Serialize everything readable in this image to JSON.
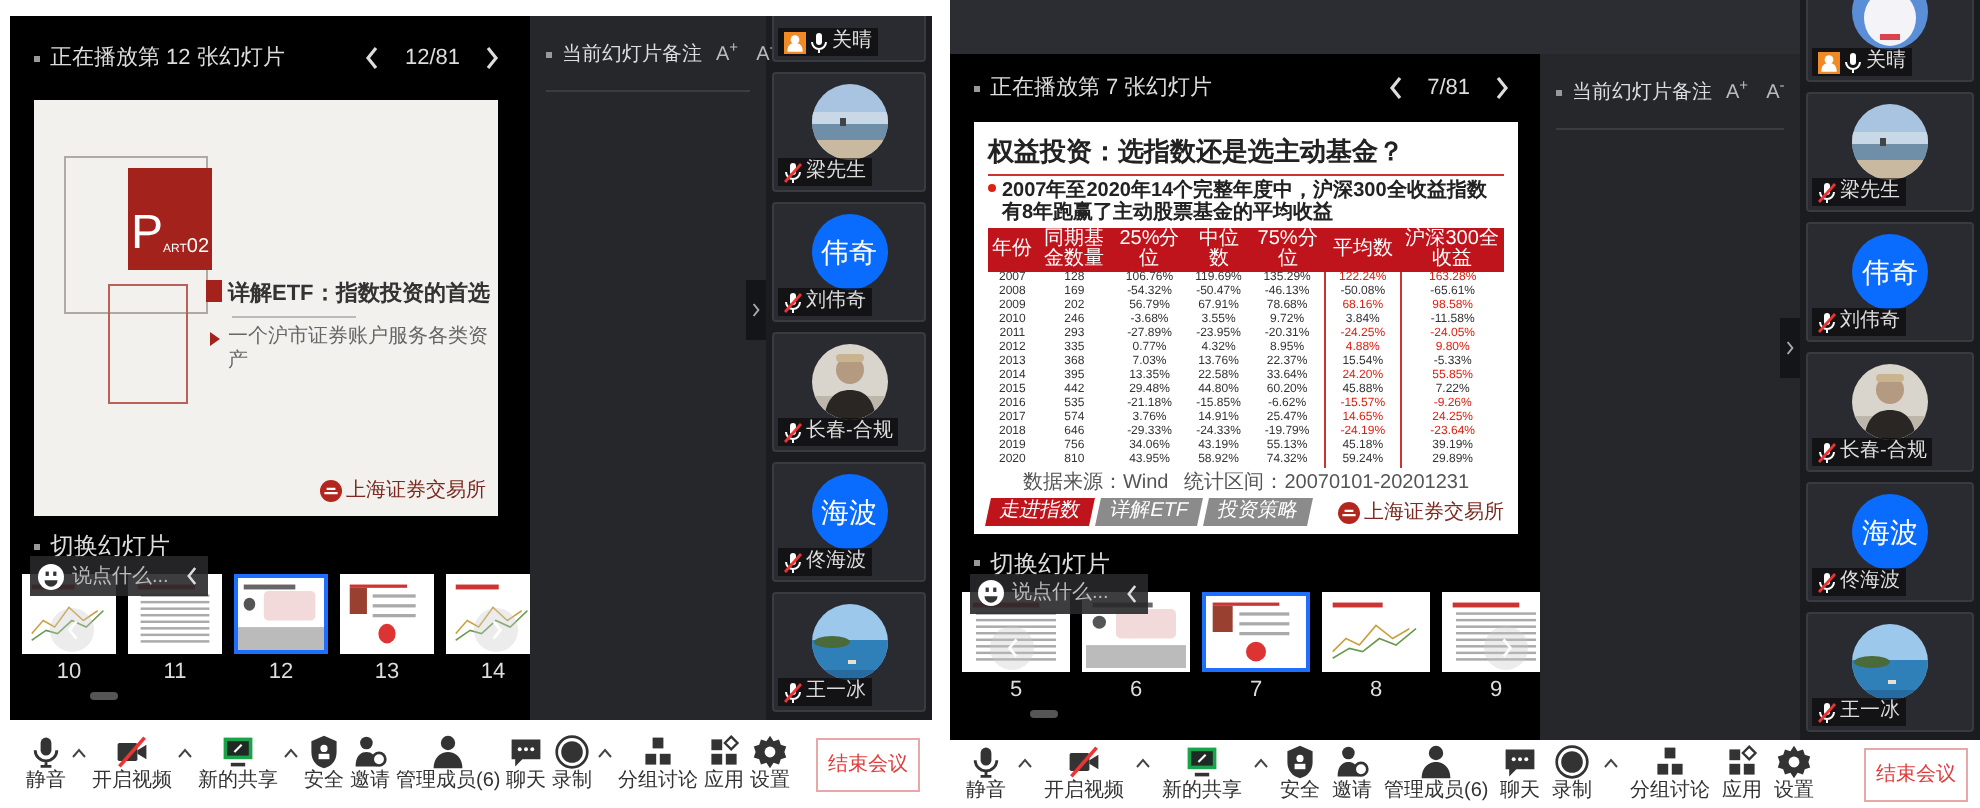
{
  "panels": [
    {
      "slide_status": "正在播放第 12 张幻灯片",
      "page": "12/81",
      "slide": {
        "kind": "section",
        "badge": {
          "letter": "P",
          "small": "ART",
          "number": "02"
        },
        "title": "详解ETF：指数投资的首选",
        "subtitle": "一个沪市证券账户服务各类资产",
        "logo": "上海证券交易所"
      },
      "switch_label": "切换幻灯片",
      "chat_placeholder": "说点什么...",
      "thumbnails": [
        {
          "number": "10",
          "selected": false
        },
        {
          "number": "11",
          "selected": false
        },
        {
          "number": "12",
          "selected": true
        },
        {
          "number": "13",
          "selected": false
        },
        {
          "number": "14",
          "selected": false
        }
      ],
      "notes": {
        "title": "当前幻灯片备注",
        "font_buttons": [
          "A$^{+}$",
          "A$^{-}$"
        ]
      },
      "participants": [
        {
          "name": "关晴",
          "host": true,
          "muted": false
        },
        {
          "name": "梁先生",
          "host": false,
          "muted": true
        },
        {
          "name": "刘伟奇",
          "kind": "initials",
          "initials": "伟奇",
          "host": false,
          "muted": true
        },
        {
          "name": "长春-合规",
          "kind": "figure",
          "host": false,
          "muted": true
        },
        {
          "name": "佟海波",
          "kind": "initials",
          "initials": "海波",
          "host": false,
          "muted": true
        },
        {
          "name": "王一冰",
          "host": false,
          "muted": true
        }
      ],
      "toolbar": [
        {
          "label": "静音",
          "kind": "mic",
          "menu": true
        },
        {
          "label": "开启视频",
          "kind": "camera_off",
          "menu": true
        },
        {
          "label": "新的共享",
          "kind": "share",
          "menu": true
        },
        {
          "label": "安全",
          "kind": "shield",
          "menu": false
        },
        {
          "label": "邀请",
          "kind": "invite",
          "menu": false
        },
        {
          "label": "管理成员(6)",
          "kind": "members",
          "menu": false
        },
        {
          "label": "聊天",
          "kind": "chat",
          "menu": false
        },
        {
          "label": "录制",
          "kind": "record",
          "menu": true
        },
        {
          "label": "分组讨论",
          "kind": "group",
          "menu": false
        },
        {
          "label": "应用",
          "kind": "apps",
          "menu": false
        },
        {
          "label": "设置",
          "kind": "gear",
          "menu": false
        }
      ],
      "end_button": "结束会议"
    },
    {
      "slide_status": "正在播放第 7 张幻灯片",
      "page": "7/81",
      "slide": {
        "kind": "table",
        "title": "权益投资：选指数还是选主动基金？",
        "summary": "2007年至2020年14个完整年度中，沪深300全收益指数有**8年**跑赢了主动股票基金的平均收益",
        "columns": [
          "年份",
          "同期基金数量",
          "25%分位",
          "中位数",
          "75%分位",
          "平均数",
          "沪深300全收益"
        ],
        "rows": [
          {
            "cells": [
              "2007",
              "128",
              "106.76%",
              "119.69%",
              "135.29%",
              "122.24%",
              "163.28%"
            ],
            "highlight": true
          },
          {
            "cells": [
              "2008",
              "169",
              "-54.32%",
              "-50.47%",
              "-46.13%",
              "-50.08%",
              "-65.61%"
            ],
            "highlight": false
          },
          {
            "cells": [
              "2009",
              "202",
              "56.79%",
              "67.91%",
              "78.68%",
              "68.16%",
              "98.58%"
            ],
            "highlight": true
          },
          {
            "cells": [
              "2010",
              "246",
              "-3.68%",
              "3.55%",
              "9.72%",
              "3.84%",
              "-11.58%"
            ],
            "highlight": false
          },
          {
            "cells": [
              "2011",
              "293",
              "-27.89%",
              "-23.95%",
              "-20.31%",
              "-24.25%",
              "-24.05%"
            ],
            "highlight": true
          },
          {
            "cells": [
              "2012",
              "335",
              "0.77%",
              "4.32%",
              "8.95%",
              "4.88%",
              "9.80%"
            ],
            "highlight": true
          },
          {
            "cells": [
              "2013",
              "368",
              "7.03%",
              "13.76%",
              "22.37%",
              "15.54%",
              "-5.33%"
            ],
            "highlight": false
          },
          {
            "cells": [
              "2014",
              "395",
              "13.35%",
              "22.58%",
              "33.64%",
              "24.20%",
              "55.85%"
            ],
            "highlight": true
          },
          {
            "cells": [
              "2015",
              "442",
              "29.48%",
              "44.80%",
              "60.20%",
              "45.88%",
              "7.22%"
            ],
            "highlight": false
          },
          {
            "cells": [
              "2016",
              "535",
              "-21.18%",
              "-15.85%",
              "-6.62%",
              "-15.57%",
              "-9.26%"
            ],
            "highlight": true
          },
          {
            "cells": [
              "2017",
              "574",
              "3.76%",
              "14.91%",
              "25.47%",
              "14.65%",
              "24.25%"
            ],
            "highlight": true
          },
          {
            "cells": [
              "2018",
              "646",
              "-29.33%",
              "-24.33%",
              "-19.79%",
              "-24.19%",
              "-23.64%"
            ],
            "highlight": true
          },
          {
            "cells": [
              "2019",
              "756",
              "34.06%",
              "43.19%",
              "55.13%",
              "45.18%",
              "39.19%"
            ],
            "highlight": false
          },
          {
            "cells": [
              "2020",
              "810",
              "43.95%",
              "58.92%",
              "74.32%",
              "59.24%",
              "29.89%"
            ],
            "highlight": false
          }
        ],
        "source": [
          "数据来源：Wind",
          "统计区间：20070101-20201231"
        ],
        "tabs": [
          {
            "label": "走进指数",
            "selected": true
          },
          {
            "label": "详解ETF",
            "selected": false
          },
          {
            "label": "投资策略",
            "selected": false
          }
        ],
        "logo": "上海证券交易所"
      },
      "switch_label": "切换幻灯片",
      "chat_placeholder": "说点什么...",
      "thumbnails": [
        {
          "number": "5",
          "selected": false
        },
        {
          "number": "6",
          "selected": false
        },
        {
          "number": "7",
          "selected": true
        },
        {
          "number": "8",
          "selected": false
        },
        {
          "number": "9",
          "selected": false
        }
      ],
      "notes": {
        "title": "当前幻灯片备注",
        "font_buttons": [
          "A$^{+}$",
          "A$^{-}$"
        ]
      },
      "participants": [
        {
          "name": "关晴",
          "host": true,
          "muted": false
        },
        {
          "name": "梁先生",
          "host": false,
          "muted": true
        },
        {
          "name": "刘伟奇",
          "kind": "initials",
          "initials": "伟奇",
          "host": false,
          "muted": true
        },
        {
          "name": "长春-合规",
          "kind": "figure",
          "host": false,
          "muted": true
        },
        {
          "name": "佟海波",
          "kind": "initials",
          "initials": "海波",
          "host": false,
          "muted": true
        },
        {
          "name": "王一冰",
          "host": false,
          "muted": true
        }
      ],
      "toolbar": [
        {
          "label": "静音",
          "kind": "mic",
          "menu": true
        },
        {
          "label": "开启视频",
          "kind": "camera_off",
          "menu": true
        },
        {
          "label": "新的共享",
          "kind": "share",
          "menu": true
        },
        {
          "label": "安全",
          "kind": "shield",
          "menu": false
        },
        {
          "label": "邀请",
          "kind": "invite",
          "menu": false
        },
        {
          "label": "管理成员(6)",
          "kind": "members",
          "menu": false
        },
        {
          "label": "聊天",
          "kind": "chat",
          "menu": false
        },
        {
          "label": "录制",
          "kind": "record",
          "menu": true
        },
        {
          "label": "分组讨论",
          "kind": "group",
          "menu": false
        },
        {
          "label": "应用",
          "kind": "apps",
          "menu": false
        },
        {
          "label": "设置",
          "kind": "gear",
          "menu": false
        }
      ],
      "end_button": "结束会议"
    }
  ]
}
